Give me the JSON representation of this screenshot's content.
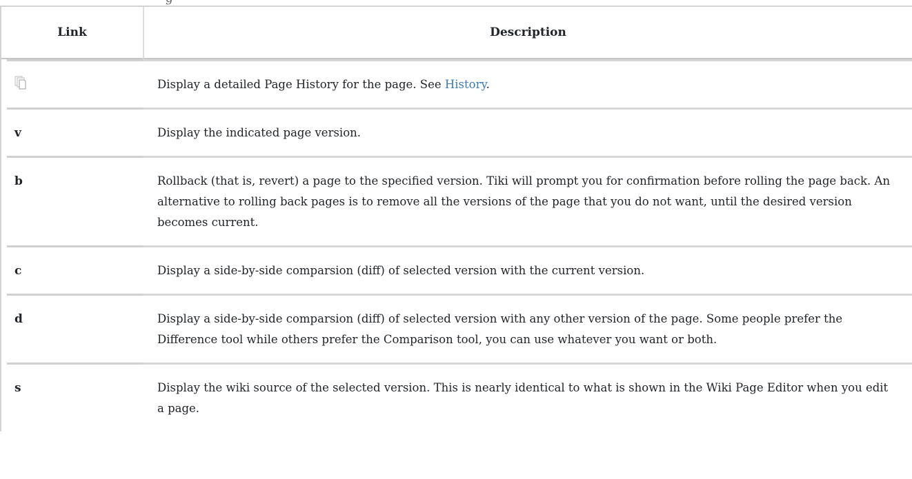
{
  "table": {
    "headers": {
      "link": "Link",
      "description": "Description"
    },
    "rows": [
      {
        "link_icon": "pages-history-icon",
        "description_before": "Display a detailed Page History for the page. See ",
        "description_link": "History",
        "description_after": "."
      },
      {
        "link": "v",
        "description": "Display the indicated page version."
      },
      {
        "link": "b",
        "description": "Rollback (that is, revert) a page to the specified version. Tiki will prompt you for confirmation before rolling the page back. An alternative to rolling back pages is to remove all the versions of the page that you do not want, until the desired version becomes current."
      },
      {
        "link": "c",
        "description": "Display a side-by-side comparsion (diff) of selected version with the current version."
      },
      {
        "link": "d",
        "description": "Display a side-by-side comparsion (diff) of selected version with any other version of the page. Some people prefer the Difference tool while others prefer the Comparison tool, you can use whatever you want or both."
      },
      {
        "link": "s",
        "description": "Display the wiki source of the selected version. This is nearly identical to what is shown in the Wiki Page Editor when you edit a page."
      }
    ]
  },
  "colors": {
    "link": "#3a79b8",
    "text": "#212529",
    "border": "#d3d3d3"
  }
}
